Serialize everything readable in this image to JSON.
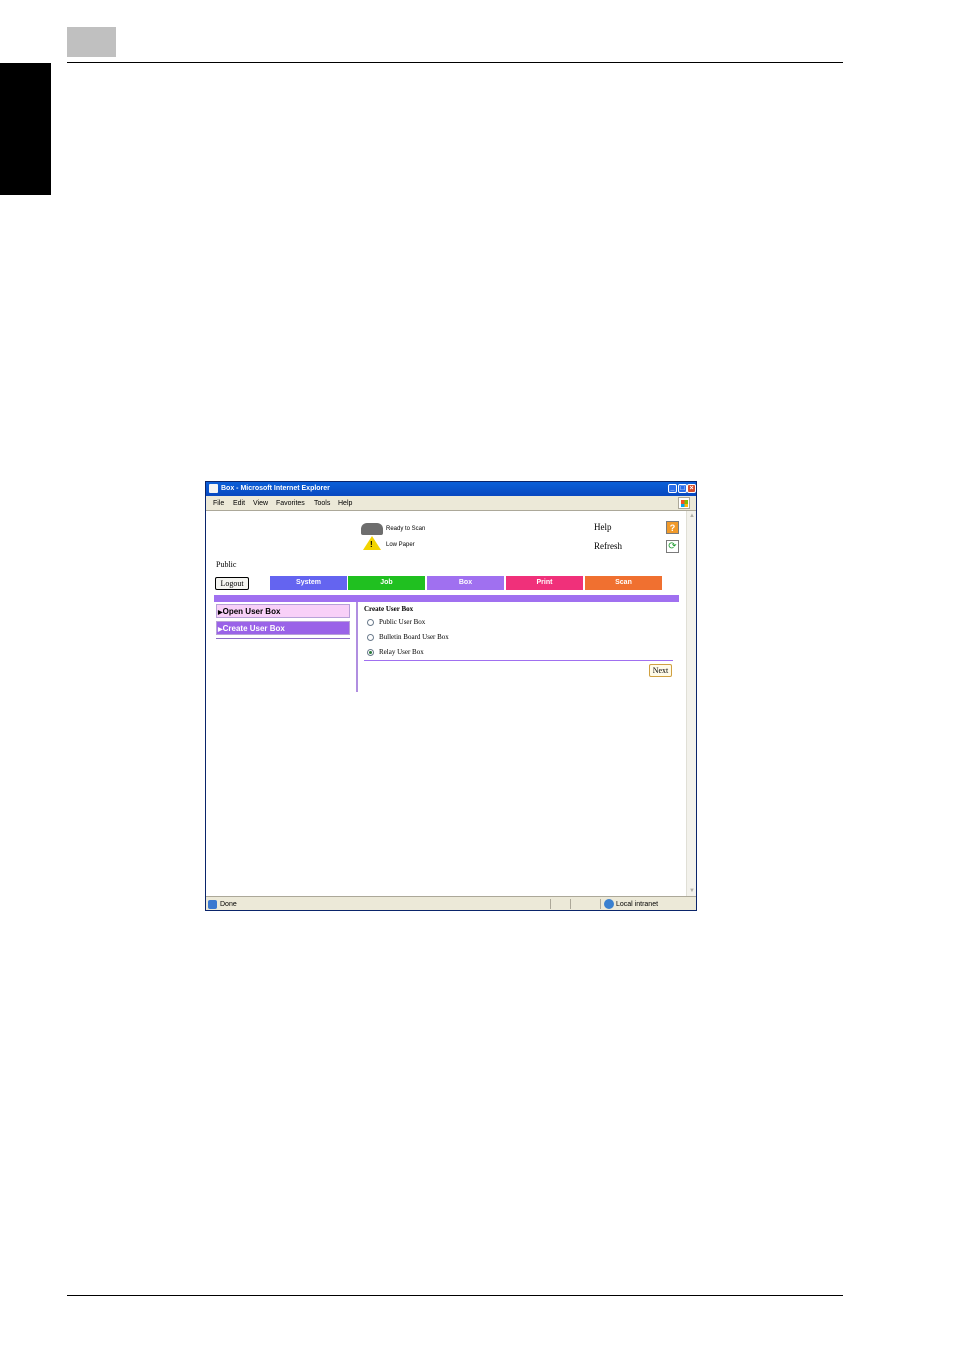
{
  "window": {
    "title": "Box - Microsoft Internet Explorer",
    "minimize": "_",
    "maximize": "□",
    "close": "×"
  },
  "menubar": {
    "items": [
      "File",
      "Edit",
      "View",
      "Favorites",
      "Tools",
      "Help"
    ]
  },
  "status": {
    "line1": "Ready to Scan",
    "line2": "Low Paper"
  },
  "links": {
    "help": "Help",
    "help_symbol": "?",
    "refresh": "Refresh",
    "refresh_symbol": "⟳"
  },
  "user": {
    "name": "Public",
    "logout_label": "Logout"
  },
  "tabs": [
    {
      "label": "System",
      "color": "#6464f0"
    },
    {
      "label": "Job",
      "color": "#20c020"
    },
    {
      "label": "Box",
      "color": "#a070f0"
    },
    {
      "label": "Print",
      "color": "#f0307a"
    },
    {
      "label": "Scan",
      "color": "#f07030"
    }
  ],
  "left_menu": {
    "open": "Open User Box",
    "create": "Create User Box",
    "arrow": "▶"
  },
  "form": {
    "title": "Create User Box",
    "options": [
      {
        "label": "Public User Box",
        "checked": false
      },
      {
        "label": "Bulletin Board User Box",
        "checked": false
      },
      {
        "label": "Relay User Box",
        "checked": true
      }
    ],
    "next_label": "Next"
  },
  "statusbar": {
    "left": "Done",
    "zone": "Local intranet"
  }
}
